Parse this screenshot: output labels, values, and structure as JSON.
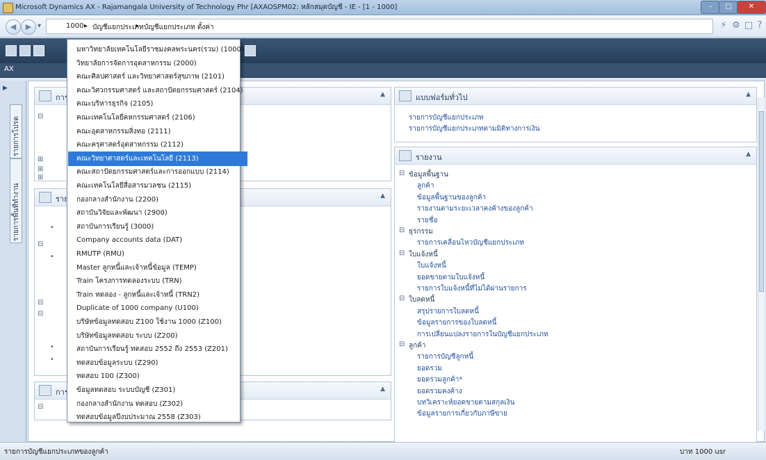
{
  "window": {
    "title": "Microsoft Dynamics AX - Rajamangala University of Technology Phr [AXAOSPM02: หลักสมุดบัญชี - IE - [1 - 1000]",
    "minimize": "–",
    "maximize": "□",
    "close": "✕"
  },
  "address_bar": {
    "back_icon": "◀",
    "forward_icon": "▶",
    "dropdown_icon": "▾",
    "crumbs": [
      "1000",
      "▸",
      "บัญชีแยกประเภท",
      "▸",
      "บัญชีแยกประเภท ตั้งค่า"
    ],
    "right_icons": [
      "⚡",
      "⚙",
      "□",
      "?"
    ]
  },
  "subbar": {
    "label": "AX"
  },
  "left_nav": {
    "tabs": [
      "รายการโปรด",
      "รายการพื้นที่ทำงาน"
    ]
  },
  "company_dropdown": {
    "items": [
      "มหาวิทยาลัยเทคโนโลยีราชมงคลพระนคร(รวม) (1000)",
      "วิทยาลัยการจัดการอุตสาหกรรม (2000)",
      "คณะศิลปศาสตร์ และวิทยาศาสตร์สุขภาพ (2101)",
      "คณะวิศวกรรมศาสตร์ และสถาปัตยกรรมศาสตร์ (2104)",
      "คณะบริหารธุรกิจ (2105)",
      "คณะเทคโนโลยีคหกรรมศาสตร์ (2106)",
      "คณะอุตสาหกรรมสิ่งทอ (2111)",
      "คณะครุศาสตร์อุตสาหกรรม (2112)",
      "คณะวิทยาศาสตร์และเทคโนโลยี (2113)",
      "คณะสถาปัตยกรรมศาสตร์และการออกแบบ (2114)",
      "คณะเทคโนโลยีสื่อสารมวลชน (2115)",
      "กองกลางสำนักงาน (2200)",
      "สถาบันวิจัยและพัฒนา (2900)",
      "สถาบันการเรียนรู้ (3000)",
      "Company accounts data (DAT)",
      "RMUTP (RMU)",
      "Master ลูกหนี้และเจ้าหนี้ข้อมูล (TEMP)",
      "Train โครงการทดลองระบบ (TRN)",
      "Train ทดลอง - ลูกหนี้และเจ้าหนี้ (TRN2)",
      "Duplicate of 1000 company (U100)",
      "บริษัทข้อมูลทดสอบ Z100 ใช้งาน 1000 (Z100)",
      "บริษัทข้อมูลทดสอบ ระบบ (Z200)",
      "สถาบันการเรียนรู้ ทดสอบ 2552 ถึง 2553 (Z201)",
      "ทดสอบข้อมูลระบบ (Z290)",
      "ทดสอบ 100 (Z300)",
      "ข้อมูลทดสอบ ระบบบัญชี (Z301)",
      "กองกลางสำนักงาน ทดสอบ (Z302)",
      "ทดสอบข้อมูลปีงบประมาณ 2558 (Z303)"
    ],
    "selected_index": 8
  },
  "left_panels": [
    {
      "title": "การสอบถาม",
      "row_count": 6
    },
    {
      "title": "รายงาน",
      "row_count": 9
    },
    {
      "title": "การตั้งค่า",
      "row_count": 1
    }
  ],
  "right_panels": {
    "common_forms": {
      "title": "แบบฟอร์มทั่วไป",
      "links": [
        "รายการบัญชีแยกประเภท",
        "รายการบัญชีแยกประเภทตามมิติทางการเงิน"
      ]
    },
    "reports": {
      "title": "รายงาน",
      "tree": [
        {
          "kind": "group",
          "text": "ข้อมูลพื้นฐาน",
          "expander": "⊟"
        },
        {
          "kind": "link",
          "text": "ลูกค้า"
        },
        {
          "kind": "link",
          "text": "ข้อมูลพื้นฐานของลูกค้า"
        },
        {
          "kind": "link",
          "text": "รายงานตามระยะเวลาคงค้างของลูกค้า"
        },
        {
          "kind": "link",
          "text": "รายชื่อ"
        },
        {
          "kind": "group",
          "text": "ธุรกรรม",
          "expander": "⊟"
        },
        {
          "kind": "link",
          "text": "รายการเคลื่อนไหวบัญชีแยกประเภท"
        },
        {
          "kind": "group",
          "text": "ใบแจ้งหนี้",
          "expander": "⊟"
        },
        {
          "kind": "link",
          "text": "ใบแจ้งหนี้"
        },
        {
          "kind": "link",
          "text": "ยอดขายตามใบแจ้งหนี้"
        },
        {
          "kind": "link",
          "text": "รายการใบแจ้งหนี้ที่ไม่ได้ผ่านรายการ"
        },
        {
          "kind": "group",
          "text": "ใบลดหนี้",
          "expander": "⊟"
        },
        {
          "kind": "link",
          "text": "สรุปรายการใบลดหนี้"
        },
        {
          "kind": "link",
          "text": "ข้อมูลรายการของใบลดหนี้"
        },
        {
          "kind": "link",
          "text": "การเปลี่ยนแปลงรายการในบัญชีแยกประเภท"
        },
        {
          "kind": "group",
          "text": "ลูกค้า",
          "expander": "⊟"
        },
        {
          "kind": "link",
          "text": "รายการบัญชีลูกหนี้"
        },
        {
          "kind": "link",
          "text": "ยอดรวม"
        },
        {
          "kind": "link",
          "text": "ยอดรวมลูกค้า*"
        },
        {
          "kind": "link",
          "text": "ยอดรวมคงค้าง"
        },
        {
          "kind": "link",
          "text": "บทวิเคราะห์ยอดขายตามสกุลเงิน"
        },
        {
          "kind": "link",
          "text": "ข้อมูลรายการเกี่ยวกับภาษีขาย"
        }
      ]
    }
  },
  "status_bar": {
    "left_text": "รายการบัญชีแยกประเภทของลูกค้า",
    "right_text": "บาท  1000  usr"
  }
}
